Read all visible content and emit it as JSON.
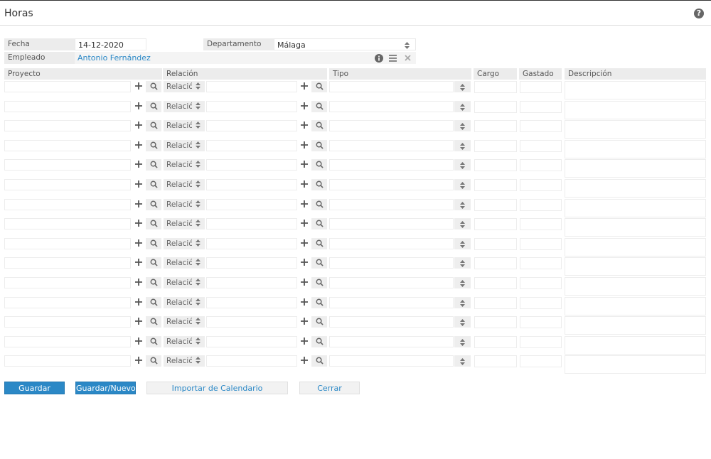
{
  "page": {
    "title": "Horas"
  },
  "form": {
    "fecha_label": "Fecha",
    "fecha_value": "14-12-2020",
    "departamento_label": "Departamento",
    "departamento_value": "Málaga",
    "empleado_label": "Empleado",
    "empleado_value": "Antonio Fernández"
  },
  "table": {
    "headers": {
      "proyecto": "Proyecto",
      "relacion": "Relación",
      "tipo": "Tipo",
      "cargo": "Cargo",
      "gastado": "Gastado",
      "descripcion": "Descripción"
    },
    "relacion_placeholder": "Relación",
    "row_count": 15
  },
  "buttons": {
    "guardar": "Guardar",
    "guardar_nuevo": "Guardar/Nuevo",
    "importar": "Importar de Calendario",
    "cerrar": "Cerrar"
  },
  "icons": {
    "help": "question-circle-icon",
    "info": "info-icon",
    "list": "list-icon",
    "clear": "close-icon",
    "add": "plus-icon",
    "search": "search-icon",
    "select": "updown-icon"
  },
  "colors": {
    "accent": "#2b88c6",
    "label_bg": "#ececec"
  }
}
